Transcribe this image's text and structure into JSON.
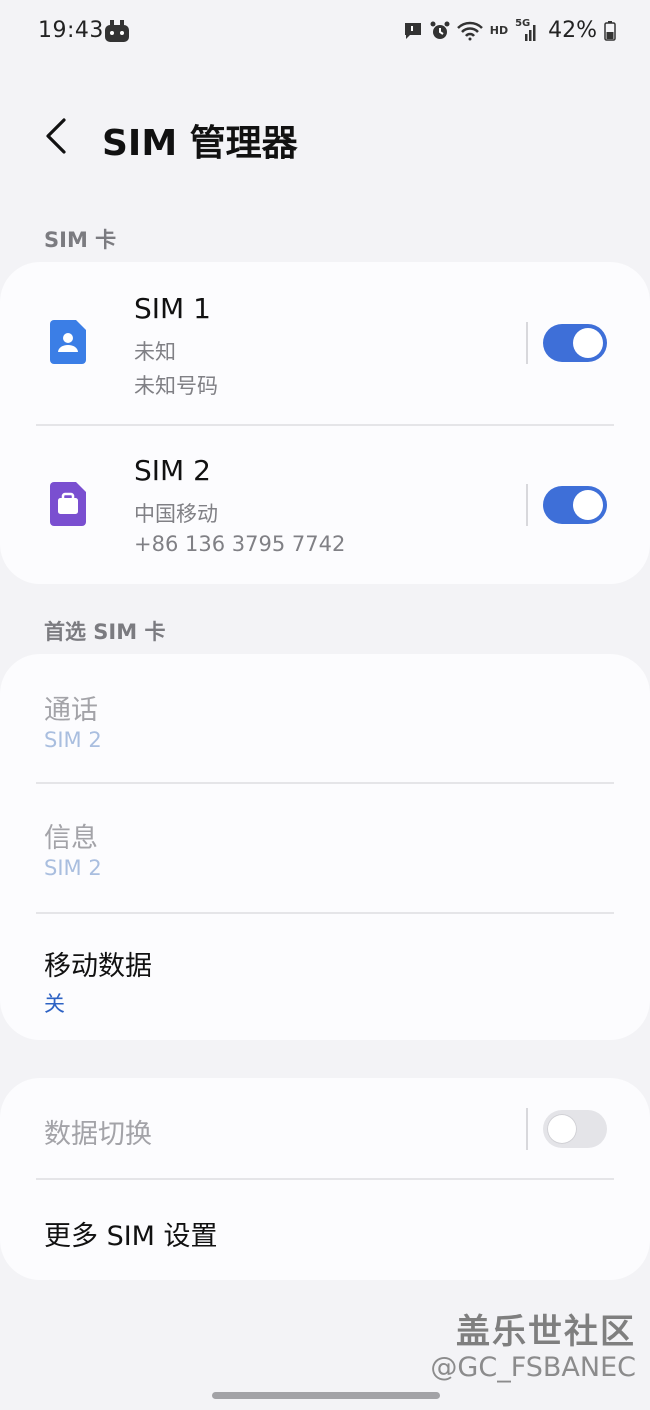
{
  "status_bar": {
    "time": "19:43",
    "battery_percent": "42%",
    "network_label": "5G",
    "hd_label": "HD",
    "icons": [
      "game-icon",
      "message-icon",
      "alarm-icon",
      "wifi-icon",
      "signal-icon",
      "battery-icon"
    ]
  },
  "header": {
    "title": "SIM 管理器"
  },
  "sim_section": {
    "label": "SIM 卡",
    "cards": [
      {
        "name": "SIM 1",
        "carrier": "未知",
        "number": "未知号码",
        "enabled": true,
        "icon_color": "#3b7ee6"
      },
      {
        "name": "SIM 2",
        "carrier": "中国移动",
        "number": "+86 136 3795 7742",
        "enabled": true,
        "icon_color": "#7a4fd0"
      }
    ]
  },
  "preferred_section": {
    "label": "首选 SIM 卡",
    "items": [
      {
        "title": "通话",
        "value": "SIM 2",
        "disabled": true
      },
      {
        "title": "信息",
        "value": "SIM 2",
        "disabled": true
      },
      {
        "title": "移动数据",
        "value": "关",
        "disabled": false
      }
    ]
  },
  "more_section": {
    "data_switch": {
      "title": "数据切换",
      "enabled": false
    },
    "more_settings": {
      "title": "更多 SIM 设置"
    }
  },
  "watermark": {
    "line1": "盖乐世社区",
    "line2": "@GC_FSBANEC"
  },
  "colors": {
    "accent": "#3e6fd8",
    "background": "#f3f3f6",
    "card": "#fcfcfe"
  }
}
